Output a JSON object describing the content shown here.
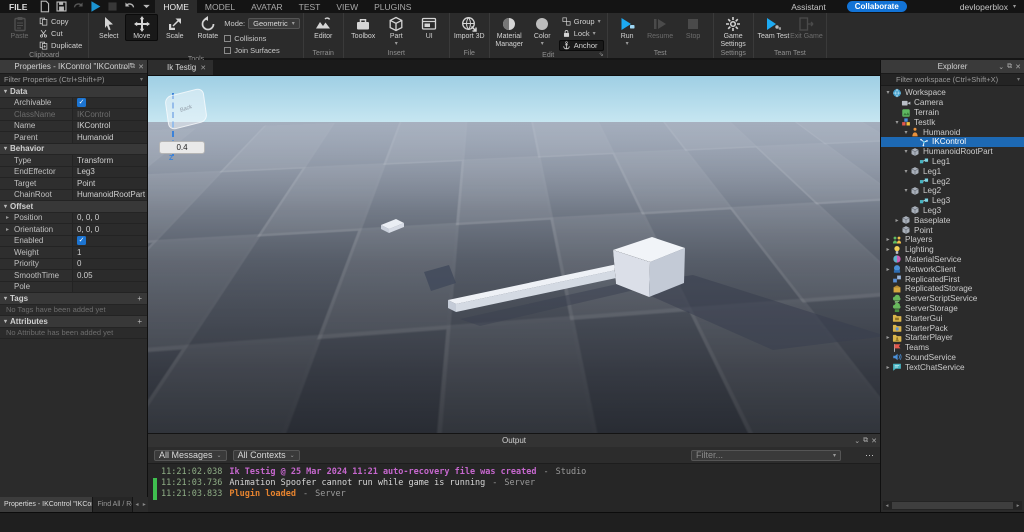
{
  "titlebar": {
    "file_menu": "FILE",
    "quick_actions": [
      {
        "icon": "new-file-icon",
        "disabled": false
      },
      {
        "icon": "save-icon",
        "disabled": false
      },
      {
        "icon": "redo-icon",
        "disabled": true
      },
      {
        "icon": "play-icon",
        "disabled": false,
        "accent": true
      },
      {
        "icon": "stop-icon",
        "disabled": true
      },
      {
        "icon": "undo-icon",
        "disabled": false
      },
      {
        "icon": "caret-down-icon",
        "disabled": false
      }
    ],
    "tabs": [
      "HOME",
      "MODEL",
      "AVATAR",
      "TEST",
      "VIEW",
      "PLUGINS"
    ],
    "active_tab": "HOME",
    "right": {
      "assistant_label": "Assistant",
      "collaborate_label": "Collaborate",
      "username": "devloperblox"
    }
  },
  "ribbon": {
    "groups": [
      {
        "label": "Clipboard",
        "big": [
          {
            "label": "Paste",
            "icon": "paste-icon",
            "disabled": true
          }
        ],
        "small": [
          {
            "label": "Copy",
            "icon": "copy-icon"
          },
          {
            "label": "Cut",
            "icon": "cut-icon"
          },
          {
            "label": "Duplicate",
            "icon": "duplicate-icon"
          }
        ]
      },
      {
        "label": "Tools",
        "big": [
          {
            "label": "Select",
            "icon": "select-icon"
          },
          {
            "label": "Move",
            "icon": "move-icon",
            "active": true
          },
          {
            "label": "Scale",
            "icon": "scale-icon"
          },
          {
            "label": "Rotate",
            "icon": "rotate-icon"
          }
        ],
        "extras": {
          "mode_label": "Mode:",
          "mode_value": "Geometric",
          "checkboxes": [
            "Collisions",
            "Join Surfaces"
          ]
        }
      },
      {
        "label": "Terrain",
        "big": [
          {
            "label": "Editor",
            "icon": "terrain-editor-icon"
          }
        ]
      },
      {
        "label": "Insert",
        "big": [
          {
            "label": "Toolbox",
            "icon": "toolbox-icon"
          },
          {
            "label": "Part",
            "icon": "part-cube-icon",
            "caret": true
          },
          {
            "label": "UI",
            "icon": "ui-icon"
          }
        ]
      },
      {
        "label": "File",
        "big": [
          {
            "label": "Import 3D",
            "icon": "import-3d-icon"
          }
        ]
      },
      {
        "label": "Edit",
        "big": [
          {
            "label": "Material Manager",
            "icon": "material-manager-icon"
          },
          {
            "label": "Color",
            "icon": "color-icon",
            "caret": true
          }
        ],
        "small": [
          {
            "label": "Group",
            "icon": "group-icon",
            "caret": true
          },
          {
            "label": "Lock",
            "icon": "lock-icon",
            "caret": true
          },
          {
            "label": "Anchor",
            "icon": "anchor-icon",
            "active": true
          }
        ],
        "launcher": true
      },
      {
        "label": "Test",
        "big": [
          {
            "label": "Run",
            "icon": "run-icon",
            "caret": true
          },
          {
            "label": "Resume",
            "icon": "resume-icon",
            "disabled": true
          },
          {
            "label": "Stop",
            "icon": "stop-square-icon",
            "disabled": true
          }
        ]
      },
      {
        "label": "Settings",
        "big": [
          {
            "label": "Game Settings",
            "icon": "game-settings-icon"
          }
        ]
      },
      {
        "label": "Team Test",
        "big": [
          {
            "label": "Team Test",
            "icon": "team-test-icon"
          },
          {
            "label": "Exit Game",
            "icon": "exit-game-icon",
            "disabled": true
          }
        ]
      }
    ]
  },
  "properties": {
    "title": "Properties - IKControl \"IKControl\"",
    "filter_placeholder": "Filter Properties (Ctrl+Shift+P)",
    "sections": [
      {
        "title": "Data",
        "rows": [
          {
            "label": "Archivable",
            "type": "check",
            "checked": true
          },
          {
            "label": "ClassName",
            "value": "IKControl",
            "muted": true
          },
          {
            "label": "Name",
            "value": "IKControl"
          },
          {
            "label": "Parent",
            "value": "Humanoid"
          }
        ]
      },
      {
        "title": "Behavior",
        "rows": [
          {
            "label": "Type",
            "value": "Transform"
          },
          {
            "label": "EndEffector",
            "value": "Leg3"
          },
          {
            "label": "Target",
            "value": "Point"
          },
          {
            "label": "ChainRoot",
            "value": "HumanoidRootPart"
          }
        ]
      },
      {
        "title": "Offset",
        "rows": [
          {
            "label": "Position",
            "value": "0, 0, 0",
            "expand": true
          },
          {
            "label": "Orientation",
            "value": "0, 0, 0",
            "expand": true
          },
          {
            "label": "Enabled",
            "type": "check",
            "checked": true
          },
          {
            "label": "Weight",
            "value": "1"
          },
          {
            "label": "Priority",
            "value": "0"
          },
          {
            "label": "SmoothTime",
            "value": "0.05"
          },
          {
            "label": "Pole",
            "value": ""
          }
        ]
      },
      {
        "title": "Tags",
        "plus": true,
        "note": "No Tags have been added yet",
        "rows": []
      },
      {
        "title": "Attributes",
        "plus": true,
        "note": "No Attribute has been added yet",
        "rows": []
      }
    ]
  },
  "viewport": {
    "tab_label": "Ik Testig",
    "drag_value": "0.4",
    "ghost_label": "Back",
    "axis_label": "Z"
  },
  "output": {
    "title": "Output",
    "filters": [
      {
        "label": "All Messages"
      },
      {
        "label": "All Contexts"
      }
    ],
    "filter_placeholder": "Filter...",
    "lines": [
      {
        "time": "11:21:02.038",
        "message": "Ik Testig @ 25 Mar 2024 11:21 auto-recovery file was created",
        "separator": "-",
        "source": "Studio",
        "style": "notice",
        "marked": false
      },
      {
        "time": "11:21:03.736",
        "message": "Animation Spoofer cannot run while game is running",
        "separator": "-",
        "source": "Server",
        "style": "plain",
        "marked": true
      },
      {
        "time": "11:21:03.833",
        "message": "Plugin loaded",
        "separator": "-",
        "source": "Server",
        "style": "warning",
        "marked": true
      }
    ]
  },
  "explorer": {
    "title": "Explorer",
    "filter_placeholder": "Filter workspace (Ctrl+Shift+X)",
    "tree": [
      {
        "label": "Workspace",
        "depth": 0,
        "arrow": "open",
        "icon": "workspace-icon"
      },
      {
        "label": "Camera",
        "depth": 1,
        "arrow": "",
        "icon": "camera-icon"
      },
      {
        "label": "Terrain",
        "depth": 1,
        "arrow": "",
        "icon": "terrain-icon"
      },
      {
        "label": "TestIk",
        "depth": 1,
        "arrow": "open",
        "icon": "model-icon"
      },
      {
        "label": "Humanoid",
        "depth": 2,
        "arrow": "open",
        "icon": "humanoid-icon"
      },
      {
        "label": "IKControl",
        "depth": 3,
        "arrow": "",
        "icon": "ikcontrol-icon",
        "selected": true
      },
      {
        "label": "HumanoidRootPart",
        "depth": 2,
        "arrow": "open",
        "icon": "part-icon"
      },
      {
        "label": "Leg1",
        "depth": 3,
        "arrow": "",
        "icon": "joint-icon"
      },
      {
        "label": "Leg1",
        "depth": 2,
        "arrow": "open",
        "icon": "part-icon"
      },
      {
        "label": "Leg2",
        "depth": 3,
        "arrow": "",
        "icon": "joint-icon"
      },
      {
        "label": "Leg2",
        "depth": 2,
        "arrow": "open",
        "icon": "part-icon"
      },
      {
        "label": "Leg3",
        "depth": 3,
        "arrow": "",
        "icon": "joint-icon"
      },
      {
        "label": "Leg3",
        "depth": 2,
        "arrow": "",
        "icon": "part-icon"
      },
      {
        "label": "Baseplate",
        "depth": 1,
        "arrow": "closed",
        "icon": "part-icon"
      },
      {
        "label": "Point",
        "depth": 1,
        "arrow": "",
        "icon": "part-icon"
      },
      {
        "label": "Players",
        "depth": 0,
        "arrow": "closed",
        "icon": "players-icon"
      },
      {
        "label": "Lighting",
        "depth": 0,
        "arrow": "closed",
        "icon": "lighting-icon"
      },
      {
        "label": "MaterialService",
        "depth": 0,
        "arrow": "",
        "icon": "material-service-icon"
      },
      {
        "label": "NetworkClient",
        "depth": 0,
        "arrow": "closed",
        "icon": "network-client-icon"
      },
      {
        "label": "ReplicatedFirst",
        "depth": 0,
        "arrow": "",
        "icon": "replicated-first-icon"
      },
      {
        "label": "ReplicatedStorage",
        "depth": 0,
        "arrow": "",
        "icon": "replicated-storage-icon"
      },
      {
        "label": "ServerScriptService",
        "depth": 0,
        "arrow": "",
        "icon": "server-script-service-icon"
      },
      {
        "label": "ServerStorage",
        "depth": 0,
        "arrow": "",
        "icon": "server-storage-icon"
      },
      {
        "label": "StarterGui",
        "depth": 0,
        "arrow": "",
        "icon": "starter-gui-icon"
      },
      {
        "label": "StarterPack",
        "depth": 0,
        "arrow": "",
        "icon": "starter-pack-icon"
      },
      {
        "label": "StarterPlayer",
        "depth": 0,
        "arrow": "closed",
        "icon": "starter-player-icon"
      },
      {
        "label": "Teams",
        "depth": 0,
        "arrow": "",
        "icon": "teams-icon"
      },
      {
        "label": "SoundService",
        "depth": 0,
        "arrow": "",
        "icon": "sound-service-icon"
      },
      {
        "label": "TextChatService",
        "depth": 0,
        "arrow": "closed",
        "icon": "text-chat-service-icon"
      }
    ]
  },
  "bottom_dock": {
    "tabs": [
      "Properties - IKControl \"IKControl\"",
      "Find All / Re"
    ],
    "active_index": 0
  },
  "colors": {
    "accent_blue": "#1273d6",
    "selection_blue": "#1d69b4",
    "play_blue": "#1daaf2",
    "timestamp_green": "#8fae86",
    "notice_magenta": "#c667ce",
    "warning_orange": "#e5832f",
    "marker_green": "#3fbf4f"
  }
}
